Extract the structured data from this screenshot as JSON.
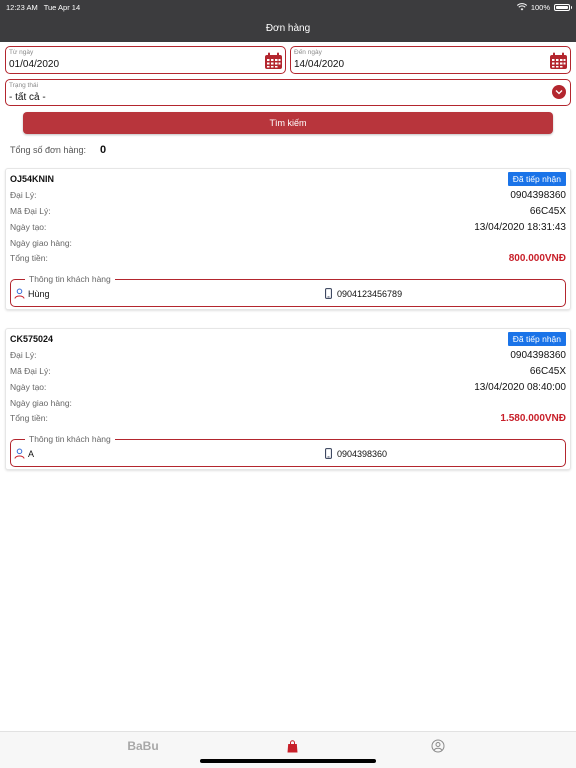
{
  "status_bar": {
    "time": "12:23 AM",
    "date": "Tue Apr 14",
    "battery": "100%"
  },
  "nav": {
    "title": "Đơn hàng"
  },
  "filters": {
    "from_label": "Từ ngày",
    "from_value": "01/04/2020",
    "to_label": "Đến ngày",
    "to_value": "14/04/2020",
    "status_label": "Trạng thái",
    "status_value": "- tất cả -",
    "search_button": "Tìm kiếm"
  },
  "summary": {
    "label": "Tổng số đơn hàng:",
    "count": "0"
  },
  "orders": [
    {
      "code": "OJ54KNIN",
      "status": "Đã tiếp nhận",
      "agent_label": "Đại Lý:",
      "agent": "0904398360",
      "agent_code_label": "Mã Đại Lý:",
      "agent_code": "66C45X",
      "created_label": "Ngày tạo:",
      "created": "13/04/2020 18:31:43",
      "delivery_label": "Ngày giao hàng:",
      "delivery": "",
      "total_label": "Tổng tiền:",
      "total": "800.000VNĐ",
      "customer_title": "Thông tin khách hàng",
      "customer_name": "Hùng",
      "customer_phone": "0904123456789"
    },
    {
      "code": "CK575024",
      "status": "Đã tiếp nhận",
      "agent_label": "Đại Lý:",
      "agent": "0904398360",
      "agent_code_label": "Mã Đại Lý:",
      "agent_code": "66C45X",
      "created_label": "Ngày tạo:",
      "created": "13/04/2020 08:40:00",
      "delivery_label": "Ngày giao hàng:",
      "delivery": "",
      "total_label": "Tổng tiền:",
      "total": "1.580.000VNĐ",
      "customer_title": "Thông tin khách hàng",
      "customer_name": "A",
      "customer_phone": "0904398360"
    }
  ],
  "tabs": {
    "brand": "BaBu"
  },
  "colors": {
    "accent": "#b3262e",
    "badge": "#1a73e8",
    "price": "#c8202a",
    "bar": "#3c3c3e"
  }
}
